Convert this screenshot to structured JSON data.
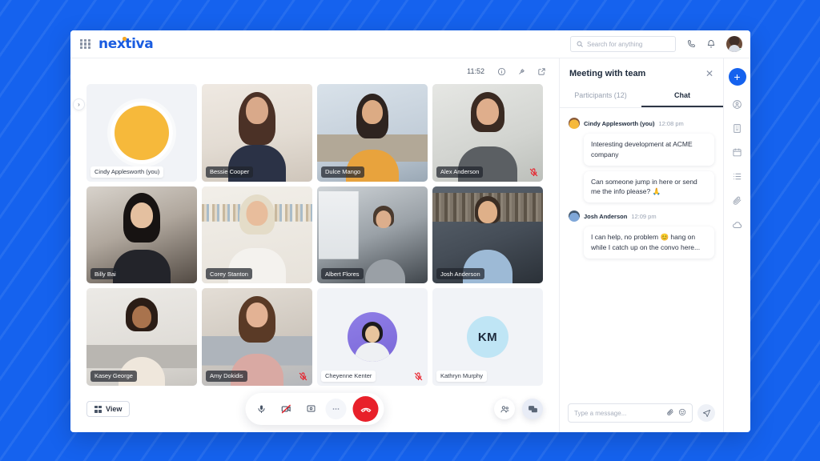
{
  "topbar": {
    "apps_icon": "grid-apps-icon",
    "logo": "nextiva",
    "search_placeholder": "Search for anything",
    "search_value": "",
    "search_icon": "search-icon",
    "phone_icon": "phone-icon",
    "bell_icon": "bell-icon",
    "avatar": "user-avatar",
    "status": "online"
  },
  "stage": {
    "expand_icon": "chevron-right-icon",
    "clock": "11:52",
    "info_icon": "info-icon",
    "pin_icon": "pin-icon",
    "popout_icon": "popout-icon"
  },
  "participants": [
    {
      "name": "Cindy Applesworth (you)",
      "type": "self",
      "muted": false
    },
    {
      "name": "Bessie Cooper",
      "type": "video",
      "muted": false
    },
    {
      "name": "Dulce Mango",
      "type": "video",
      "muted": false
    },
    {
      "name": "Alex Anderson",
      "type": "video",
      "muted": true
    },
    {
      "name": "Billy Bai",
      "type": "video",
      "muted": false
    },
    {
      "name": "Corey Stanton",
      "type": "video",
      "muted": false
    },
    {
      "name": "Albert Flores",
      "type": "video",
      "muted": false
    },
    {
      "name": "Josh Anderson",
      "type": "video",
      "muted": false
    },
    {
      "name": "Kasey George",
      "type": "video",
      "muted": false
    },
    {
      "name": "Amy Dokidis",
      "type": "video",
      "muted": true
    },
    {
      "name": "Cheyenne Kenter",
      "type": "avatar",
      "muted": true
    },
    {
      "name": "Kathryn Murphy",
      "type": "initials",
      "initials": "KM",
      "muted": false
    }
  ],
  "controls": {
    "view_label": "View",
    "view_icon": "grid-view-icon",
    "mic_icon": "microphone-icon",
    "camera_icon": "camera-off-icon",
    "share_icon": "share-screen-icon",
    "more_icon": "more-options-icon",
    "end_call_icon": "end-call-icon",
    "participants_icon": "participants-icon",
    "chat_icon": "chat-icon"
  },
  "chat": {
    "title": "Meeting with team",
    "close_icon": "close-icon",
    "tabs": [
      {
        "label": "Participants (12)",
        "active": false
      },
      {
        "label": "Chat",
        "active": true
      }
    ],
    "messages": [
      {
        "author": "Cindy Applesworth (you)",
        "time": "12:08 pm",
        "avatar": "cindy-avatar",
        "bubbles": [
          "Interesting development at ACME company",
          "Can someone jump in here or send me the info please? 🙏"
        ]
      },
      {
        "author": "Josh Anderson",
        "time": "12:09 pm",
        "avatar": "josh-avatar",
        "bubbles": [
          "I can help, no problem 😊 hang on while I catch up on the convo here..."
        ]
      }
    ],
    "composer": {
      "placeholder": "Type a message...",
      "value": "",
      "attach_icon": "paperclip-icon",
      "emoji_icon": "emoji-icon",
      "send_icon": "send-icon"
    }
  },
  "rail": {
    "add_label": "+",
    "items": [
      "contacts-icon",
      "building-icon",
      "calendar-icon",
      "list-icon",
      "paperclip-icon",
      "cloud-icon"
    ]
  },
  "colors": {
    "brand_blue": "#1562ee",
    "logo_blue": "#1a5ce0",
    "logo_accent": "#f5a623",
    "end_call_red": "#e8202a",
    "online_green": "#19c37d",
    "initials_bg": "#bfe5f5"
  }
}
